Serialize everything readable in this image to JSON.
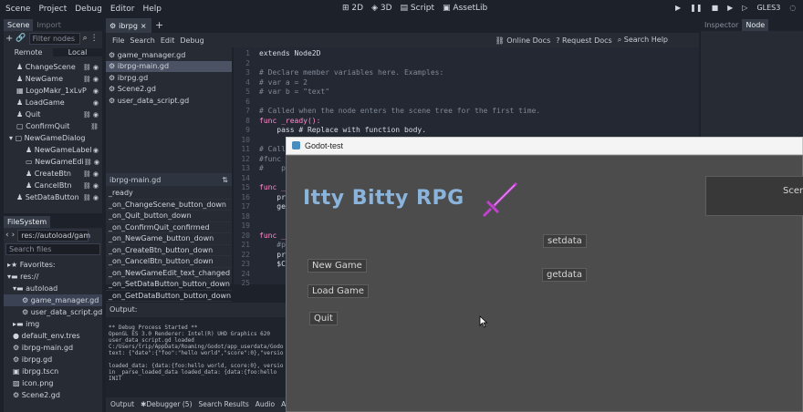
{
  "menubar": {
    "items": [
      "Scene",
      "Project",
      "Debug",
      "Editor",
      "Help"
    ]
  },
  "workspaces": [
    "2D",
    "3D",
    "Script",
    "AssetLib"
  ],
  "renderer": "GLES3",
  "scene_dock": {
    "tabs": [
      "Scene",
      "Import"
    ],
    "filter_placeholder": "Filter nodes",
    "remote": "Remote",
    "local": "Local",
    "nodes": [
      "ChangeScene",
      "NewGame",
      "LogoMakr_1xLvP",
      "LoadGame",
      "Quit",
      "ConfirmQuit",
      "NewGameDialog",
      "NewGameLabel",
      "NewGameEdi",
      "CreateBtn",
      "CancelBtn",
      "SetDataButton"
    ]
  },
  "filesystem": {
    "tab": "FileSystem",
    "path": "res://autoload/gam",
    "search_placeholder": "Search files",
    "favorites": "Favorites:",
    "root": "res://",
    "items": [
      "autoload",
      "game_manager.gd",
      "user_data_script.gd",
      "img",
      "default_env.tres",
      "ibrpg-main.gd",
      "ibrpg.gd",
      "ibrpg.tscn",
      "icon.png",
      "Scene2.gd"
    ]
  },
  "script_editor": {
    "tab": "ibrpg",
    "menu": [
      "File",
      "Search",
      "Edit",
      "Debug"
    ],
    "links": [
      "Online Docs",
      "Request Docs",
      "Search Help"
    ],
    "open_scripts": [
      "game_manager.gd",
      "ibrpg-main.gd",
      "ibrpg.gd",
      "Scene2.gd",
      "user_data_script.gd"
    ],
    "current_script": "ibrpg-main.gd",
    "methods": [
      "_ready",
      "_on_ChangeScene_button_down",
      "_on_Quit_button_down",
      "_on_ConfirmQuit_confirmed",
      "_on_NewGame_button_down",
      "_on_CreateBtn_button_down",
      "_on_CancelBtn_button_down",
      "_on_NewGameEdit_text_changed",
      "_on_SetDataButton_button_down",
      "_on_GetDataButton_button_down"
    ],
    "code": [
      {
        "n": "1",
        "t": "extends Node2D",
        "c": "tx"
      },
      {
        "n": "2",
        "t": "",
        "c": "tx"
      },
      {
        "n": "3",
        "t": "# Declare member variables here. Examples:",
        "c": "cm"
      },
      {
        "n": "4",
        "t": "# var a = 2",
        "c": "cm"
      },
      {
        "n": "5",
        "t": "# var b = \"text\"",
        "c": "cm"
      },
      {
        "n": "6",
        "t": "",
        "c": "tx"
      },
      {
        "n": "7",
        "t": "# Called when the node enters the scene tree for the first time.",
        "c": "cm"
      },
      {
        "n": "8",
        "t": "func _ready():",
        "c": "kw"
      },
      {
        "n": "9",
        "t": "    pass # Replace with function body.",
        "c": "tx"
      },
      {
        "n": "10",
        "t": "",
        "c": "tx"
      },
      {
        "n": "11",
        "t": "# Call",
        "c": "cm"
      },
      {
        "n": "12",
        "t": "#func",
        "c": "cm"
      },
      {
        "n": "13",
        "t": "#    pa",
        "c": "cm"
      },
      {
        "n": "14",
        "t": "",
        "c": "tx"
      },
      {
        "n": "15",
        "t": "func _",
        "c": "kw"
      },
      {
        "n": "16",
        "t": "    pr",
        "c": "tx"
      },
      {
        "n": "17",
        "t": "    ge",
        "c": "tx"
      },
      {
        "n": "18",
        "t": "",
        "c": "tx"
      },
      {
        "n": "19",
        "t": "",
        "c": "tx"
      },
      {
        "n": "20",
        "t": "func _",
        "c": "kw"
      },
      {
        "n": "21",
        "t": "    #p",
        "c": "cm"
      },
      {
        "n": "22",
        "t": "    pr",
        "c": "tx"
      },
      {
        "n": "23",
        "t": "    $C",
        "c": "tx"
      },
      {
        "n": "24",
        "t": "",
        "c": "tx"
      },
      {
        "n": "25",
        "t": "",
        "c": "tx"
      }
    ]
  },
  "output": {
    "title": "Output:",
    "lines": [
      "** Debug Process Started **",
      "OpenGL ES 3.0 Renderer: Intel(R) UHD Graphics 620",
      "user_data_script.gd loaded",
      "C:/Users/trip/AppData/Roaming/Godot/app_userdata/Godo",
      "text: {\"date\":{\"foo\":\"hello world\",\"score\":0},\"versio",
      "",
      "loaded_data: {data:{foo:hello world, score:0}, versio",
      "in _parse_loaded_data loaded_data: {data:{foo:hello",
      "INIT"
    ],
    "tabs": [
      "Output",
      "Debugger (5)",
      "Search Results",
      "Audio",
      "Anima"
    ]
  },
  "right_dock": {
    "tabs": [
      "Inspector",
      "Node"
    ]
  },
  "game_window": {
    "title": "Godot-test",
    "logo": "Itty Bitty RPG",
    "buttons": [
      "New Game",
      "Load Game",
      "Quit"
    ],
    "setdata": "setdata",
    "getdata": "getdata",
    "scene_btn": "Scene"
  }
}
